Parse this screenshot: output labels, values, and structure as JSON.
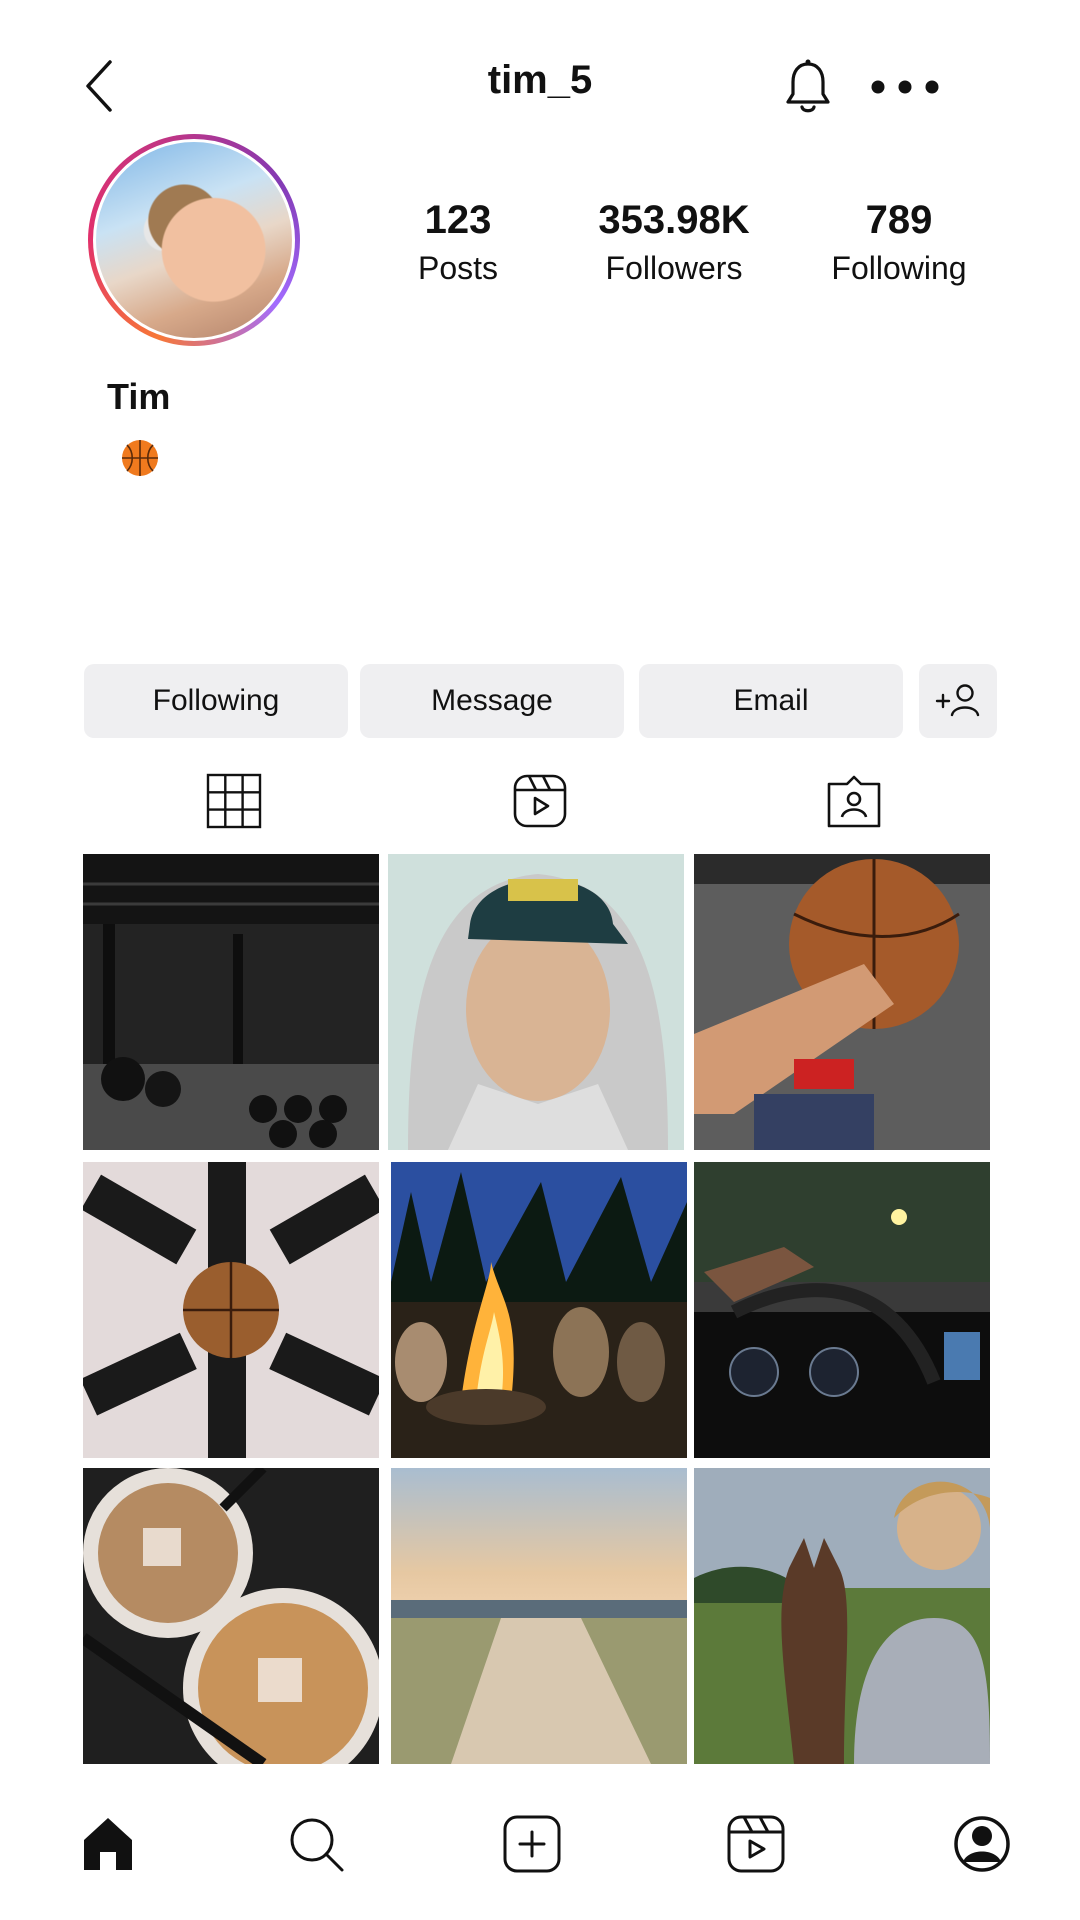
{
  "header": {
    "username": "tim_5",
    "icons": [
      "back-icon",
      "bell-icon",
      "more-icon"
    ]
  },
  "profile": {
    "name": "Tim",
    "bio_emoji": "basketball-icon",
    "stats": [
      {
        "value": "123",
        "label": "Posts"
      },
      {
        "value": "353.98K",
        "label": "Followers"
      },
      {
        "value": "789",
        "label": "Following"
      }
    ]
  },
  "actions": {
    "following_label": "Following",
    "message_label": "Message",
    "email_label": "Email",
    "add_user_icon": "add-user-icon"
  },
  "tabs": [
    "grid-icon",
    "reels-icon",
    "tagged-icon"
  ],
  "posts": [
    {
      "subject": "gym",
      "colors": [
        "#1d1d1d",
        "#3b3b3b",
        "#8a8a8a"
      ]
    },
    {
      "subject": "selfie-cap-hoodie",
      "colors": [
        "#cfd6d2",
        "#d8b59a",
        "#223a3d"
      ]
    },
    {
      "subject": "basketball-hand",
      "colors": [
        "#5b5b5b",
        "#a35a2c",
        "#e1b08c"
      ]
    },
    {
      "subject": "shoes-basketball-circle",
      "colors": [
        "#dcdcdc",
        "#1b1b1b",
        "#a36a3a"
      ]
    },
    {
      "subject": "campfire-night",
      "colors": [
        "#1b2e6a",
        "#0f1f16",
        "#ff9b2f"
      ]
    },
    {
      "subject": "car-dashboard-night",
      "colors": [
        "#2a3a2a",
        "#0e0e0e",
        "#f0e6a0"
      ]
    },
    {
      "subject": "iced-coffee",
      "colors": [
        "#3a2a20",
        "#c7a07a",
        "#e8e2dc"
      ]
    },
    {
      "subject": "beach-path-sunset",
      "colors": [
        "#aebfcd",
        "#e7c49c",
        "#8a8f6a"
      ]
    },
    {
      "subject": "boy-with-horse",
      "colors": [
        "#9aa6b2",
        "#5a7a3a",
        "#4a2f22"
      ]
    }
  ],
  "bottom_nav": [
    "home-icon",
    "search-icon",
    "create-icon",
    "reels-icon",
    "profile-icon"
  ],
  "colors": {
    "button_bg": "#efeff1",
    "text": "#111111",
    "avatar_ring": [
      "#f77737",
      "#c13584",
      "#a26cff"
    ]
  }
}
